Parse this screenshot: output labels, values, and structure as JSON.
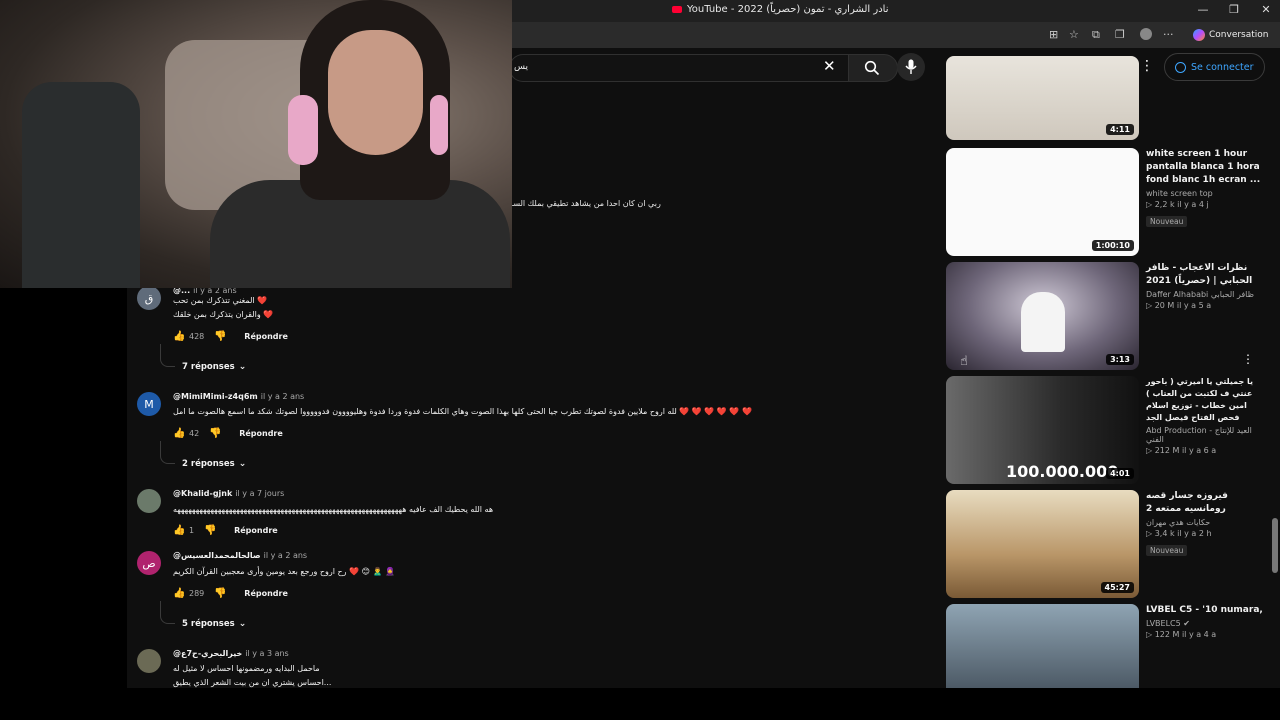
{
  "window": {
    "title": "YouTube - 2022 (حصرياً) نادر الشراري - تمون",
    "controls": [
      "—",
      "❐",
      "✕"
    ]
  },
  "browser": {
    "conversation_label": "Conversation"
  },
  "youtube": {
    "search_value": "يس",
    "signin_label": "Se connecter"
  },
  "comments": {
    "top_line": "ربي ان كان احدا من يشاهد تطيقي بملك السـ",
    "items": [
      {
        "avatar_letter": "ق",
        "avatar_color": "#5f6b7a",
        "handle": "@...",
        "time": "il y a 2 ans",
        "lines": [
          "المغني تتذكرك بمن تحب ❤️",
          "والقران يتذكرك بمن خلقك ❤️"
        ],
        "likes": "428",
        "reply_label": "Répondre",
        "replies_label": "7 réponses"
      },
      {
        "avatar_letter": "M",
        "avatar_color": "#1e5aa8",
        "handle": "@MimiMimi-z4q6m",
        "time": "il y a 2 ans",
        "lines": [
          "لله اروح ملايين فدوة لصوتك تطرب جيا الحتى كلها بهذا الصوت وهاي الكلمات فدوة وردا فدوة وهليوووون فدوووووا لصوتك شكد ما اسمع هالصوت ما امل ❤️ ❤️ ❤️ ❤️ ❤️ ❤️"
        ],
        "likes": "42",
        "reply_label": "Répondre",
        "replies_label": "2 réponses"
      },
      {
        "avatar_letter": "",
        "avatar_color": "#6b7a6a",
        "handle": "@Khalid-gjnk",
        "time": "il y a 7 jours",
        "lines": [
          "هه الله يحطيك الف عافيه ههههههههههههههههههههههههههههههههههههههههههههههههههههههههههههههه"
        ],
        "likes": "1",
        "reply_label": "Répondre",
        "replies_label": ""
      },
      {
        "avatar_letter": "ص",
        "avatar_color": "#b0236e",
        "handle": "@صالحالمحمدالعسيس",
        "time": "il y a 2 ans",
        "lines": [
          "رح اروح ورجع بعد يومين وأرى معجبين القرآن الكريم ❤️ 😊 🙎‍♂️ 🧕"
        ],
        "likes": "289",
        "reply_label": "Répondre",
        "replies_label": "5 réponses"
      },
      {
        "avatar_letter": "",
        "avatar_color": "#6b6a55",
        "handle": "@خيرالبحري-ح7ع",
        "time": "il y a 3 ans",
        "lines": [
          "ماحمل البدايه ورمضمونها احساس لا مثيل له",
          "احساس يشتري ان من بيت الشعر الذي يطيق..."
        ],
        "likes": "",
        "reply_label": "",
        "replies_label": ""
      }
    ]
  },
  "recommendations": [
    {
      "title": "",
      "channel": "",
      "meta": "",
      "duration": "4:11",
      "badge": "",
      "thumb_style": "light"
    },
    {
      "title": "white screen 1 hour pantalla blanca 1 hora fond blanc 1h   ecran ...",
      "channel": "white screen top",
      "meta": "▷ 2,2 k   il y a 4 j",
      "duration": "1:00:10",
      "badge": "Nouveau",
      "thumb_style": "white"
    },
    {
      "title": "نظرات الاعجاب - ظافر الحبابي | (حصرياً) 2021",
      "channel": "Daffer Alhababi ظافر الحبابي",
      "meta": "▷ 20 M   il y a 5 a",
      "duration": "3:13",
      "badge": "",
      "thumb_style": "stage"
    },
    {
      "title": "يا جميلتي يا اميرتي ( باحور عنتي ف لكتبت من العتاب ) امين خطاب - توزيع اسلام فحص الفتاح فيصل الجد",
      "channel": "Abd Production - العيد للإنتاج الفني",
      "meta": "▷ 212 M   il y a 6 a",
      "duration": "4:01",
      "badge": "",
      "thumb_style": "bw"
    },
    {
      "title": "فيروزه جسار قصه رومانسيه ممتعه 2",
      "channel": "حكايات هدي مهران",
      "meta": "▷ 3,4 k   il y a 2 h",
      "duration": "45:27",
      "badge": "Nouveau",
      "thumb_style": "cartoon"
    },
    {
      "title": "LVBEL C5 - '10 numara,",
      "channel": "LVBELC5 ✔",
      "meta": "▷ 122 M   il y a 4 a",
      "duration": "",
      "badge": "",
      "thumb_style": "dark"
    }
  ]
}
